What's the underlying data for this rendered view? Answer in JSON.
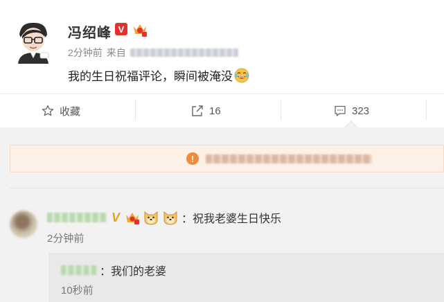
{
  "post": {
    "author": "冯绍峰",
    "verified_badge": "V",
    "time": "2分钟前",
    "source_prefix": "来自",
    "text": "我的生日祝福评论，瞬间被淹没"
  },
  "toolbar": {
    "favorite_label": "收藏",
    "repost_count": "16",
    "comment_count": "323"
  },
  "notice": {
    "icon": "!"
  },
  "comment": {
    "text": "：祝我老婆生日快乐",
    "time": "2分钟前"
  },
  "reply": {
    "text": "：我们的老婆",
    "time": "10秒前"
  },
  "colors": {
    "accent_red": "#e5302e",
    "notice_bg": "#fdf0e6",
    "warn": "#f08a3c"
  }
}
